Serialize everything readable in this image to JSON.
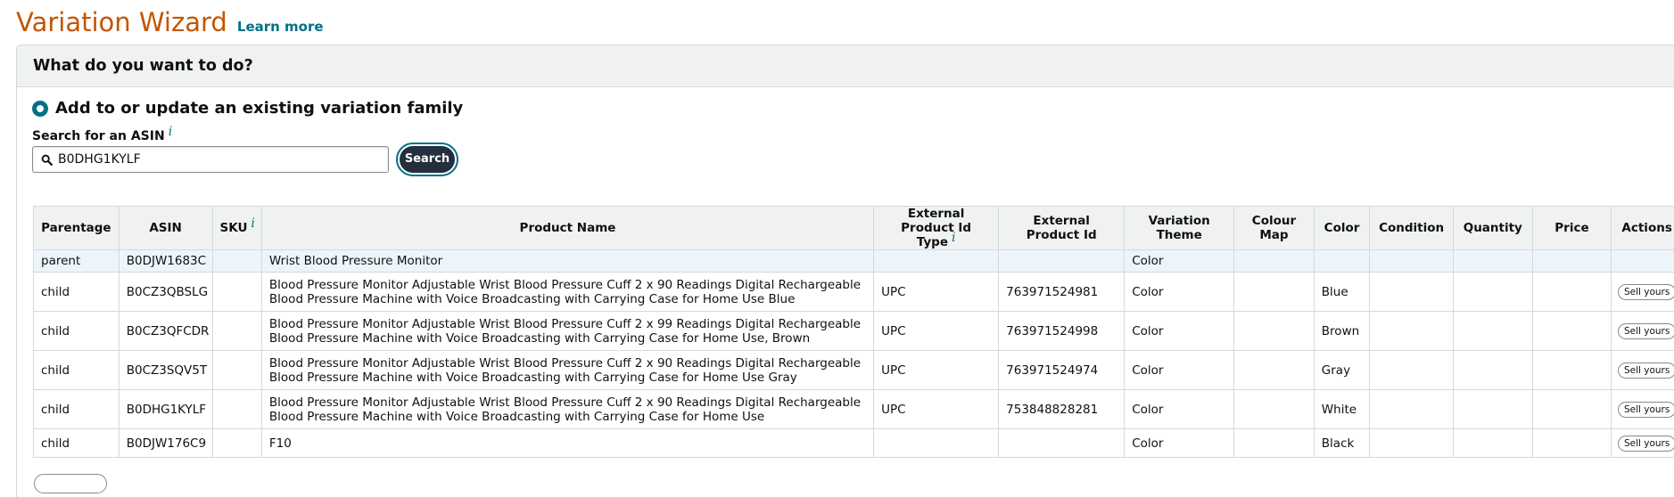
{
  "header": {
    "title": "Variation Wizard",
    "learn_more": "Learn more"
  },
  "question": "What do you want to do?",
  "option": {
    "label": "Add to or update an existing variation family",
    "selected": true
  },
  "search": {
    "label": "Search for an ASIN",
    "info": "i",
    "value": "B0DHG1KYLF",
    "button": "Search"
  },
  "table": {
    "columns": {
      "parentage": "Parentage",
      "asin": "ASIN",
      "sku": "SKU",
      "sku_info": "i",
      "product_name": "Product Name",
      "ext_id_type": "External Product Id Type",
      "ext_id_type_info": "i",
      "ext_id": "External Product Id",
      "theme": "Variation Theme",
      "colour_map": "Colour Map",
      "color": "Color",
      "condition": "Condition",
      "quantity": "Quantity",
      "price": "Price",
      "actions": "Actions"
    },
    "sell_label": "Sell yours",
    "rows": [
      {
        "parentage": "parent",
        "asin": "B0DJW1683C",
        "sku": "",
        "name": "Wrist Blood Pressure Monitor",
        "id_type": "",
        "ext_id": "",
        "theme": "Color",
        "colour_map": "",
        "color": "",
        "condition": "",
        "quantity": "",
        "price": ""
      },
      {
        "parentage": "child",
        "asin": "B0CZ3QBSLG",
        "sku": "",
        "name": "Blood Pressure Monitor Adjustable Wrist Blood Pressure Cuff 2 x 90 Readings Digital Rechargeable Blood Pressure Machine with Voice Broadcasting with Carrying Case for Home Use Blue",
        "id_type": "UPC",
        "ext_id": "763971524981",
        "theme": "Color",
        "colour_map": "",
        "color": "Blue",
        "condition": "",
        "quantity": "",
        "price": ""
      },
      {
        "parentage": "child",
        "asin": "B0CZ3QFCDR",
        "sku": "",
        "name": "Blood Pressure Monitor Adjustable Wrist Blood Pressure Cuff 2 x 99 Readings Digital Rechargeable Blood Pressure Machine with Voice Broadcasting with Carrying Case for Home Use, Brown",
        "id_type": "UPC",
        "ext_id": "763971524998",
        "theme": "Color",
        "colour_map": "",
        "color": "Brown",
        "condition": "",
        "quantity": "",
        "price": ""
      },
      {
        "parentage": "child",
        "asin": "B0CZ3SQV5T",
        "sku": "",
        "name": "Blood Pressure Monitor Adjustable Wrist Blood Pressure Cuff 2 x 90 Readings Digital Rechargeable Blood Pressure Machine with Voice Broadcasting with Carrying Case for Home Use Gray",
        "id_type": "UPC",
        "ext_id": "763971524974",
        "theme": "Color",
        "colour_map": "",
        "color": "Gray",
        "condition": "",
        "quantity": "",
        "price": ""
      },
      {
        "parentage": "child",
        "asin": "B0DHG1KYLF",
        "sku": "",
        "name": "Blood Pressure Monitor Adjustable Wrist Blood Pressure Cuff 2 x 90 Readings Digital Rechargeable Blood Pressure Machine with Voice Broadcasting with Carrying Case for Home Use",
        "id_type": "UPC",
        "ext_id": "753848828281",
        "theme": "Color",
        "colour_map": "",
        "color": "White",
        "condition": "",
        "quantity": "",
        "price": ""
      },
      {
        "parentage": "child",
        "asin": "B0DJW176C9",
        "sku": "",
        "name": "F10",
        "id_type": "",
        "ext_id": "",
        "theme": "Color",
        "colour_map": "",
        "color": "Black",
        "condition": "",
        "quantity": "",
        "price": ""
      }
    ]
  },
  "colors": {
    "title": "#c45500",
    "link": "#007185",
    "button_dark": "#232f3e",
    "header_bg": "#f0f2f2",
    "parent_row_bg": "#edf5fb"
  }
}
